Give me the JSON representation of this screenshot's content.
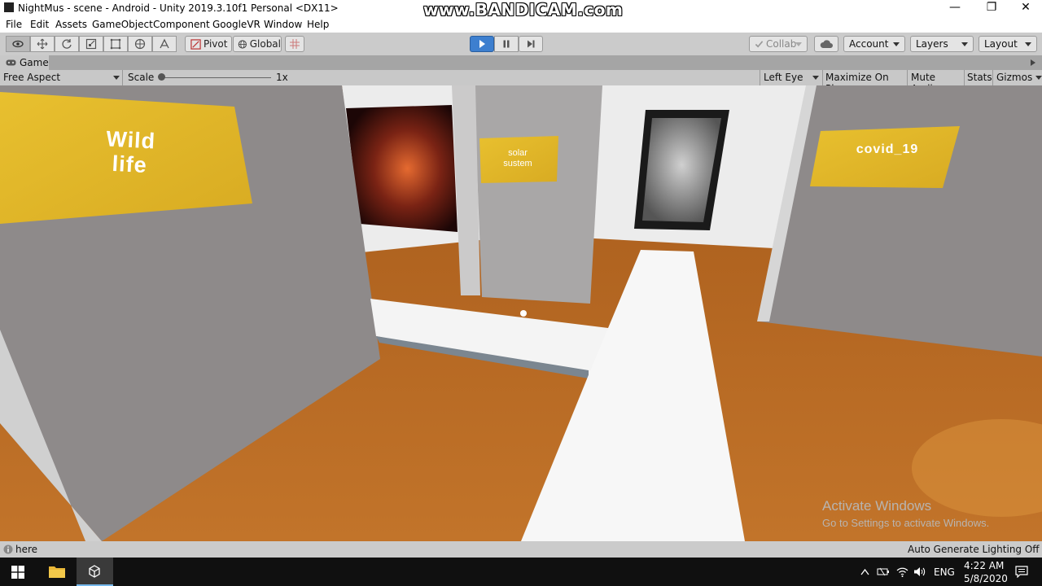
{
  "window": {
    "title": "NightMus - scene - Android - Unity 2019.3.10f1 Personal <DX11>",
    "watermark": "www.BANDICAM.com",
    "minimize_glyph": "—",
    "maximize_glyph": "❐",
    "close_glyph": "✕"
  },
  "menu": [
    "File",
    "Edit",
    "Assets",
    "GameObject",
    "Component",
    "GoogleVR",
    "Window",
    "Help"
  ],
  "toolbar": {
    "pivot_label": "Pivot",
    "global_label": "Global",
    "collab_label": "Collab",
    "account_label": "Account",
    "layers_label": "Layers",
    "layout_label": "Layout"
  },
  "game_tab": {
    "label": "Game",
    "aspect": "Free Aspect",
    "scale_label": "Scale",
    "scale_value": "1x",
    "eye": "Left Eye",
    "maximize_on_play": "Maximize On Play",
    "mute_audio": "Mute Audio",
    "stats": "Stats",
    "gizmos": "Gizmos"
  },
  "scene": {
    "sign_wildlife_line1": "Wild",
    "sign_wildlife_line2": "life",
    "sign_solar_line1": "solar",
    "sign_solar_line2": "sustem",
    "sign_covid": "covid_19",
    "activate_title": "Activate Windows",
    "activate_subtitle": "Go to Settings to activate Windows."
  },
  "status": {
    "message": "here",
    "lighting": "Auto Generate Lighting Off"
  },
  "taskbar": {
    "language": "ENG",
    "time": "4:22 AM",
    "date": "5/8/2020"
  },
  "colors": {
    "floor": "#b56a22",
    "wall": "#8e8a8a",
    "sign": "#e0b92b",
    "play_active": "#3d7fcf"
  }
}
